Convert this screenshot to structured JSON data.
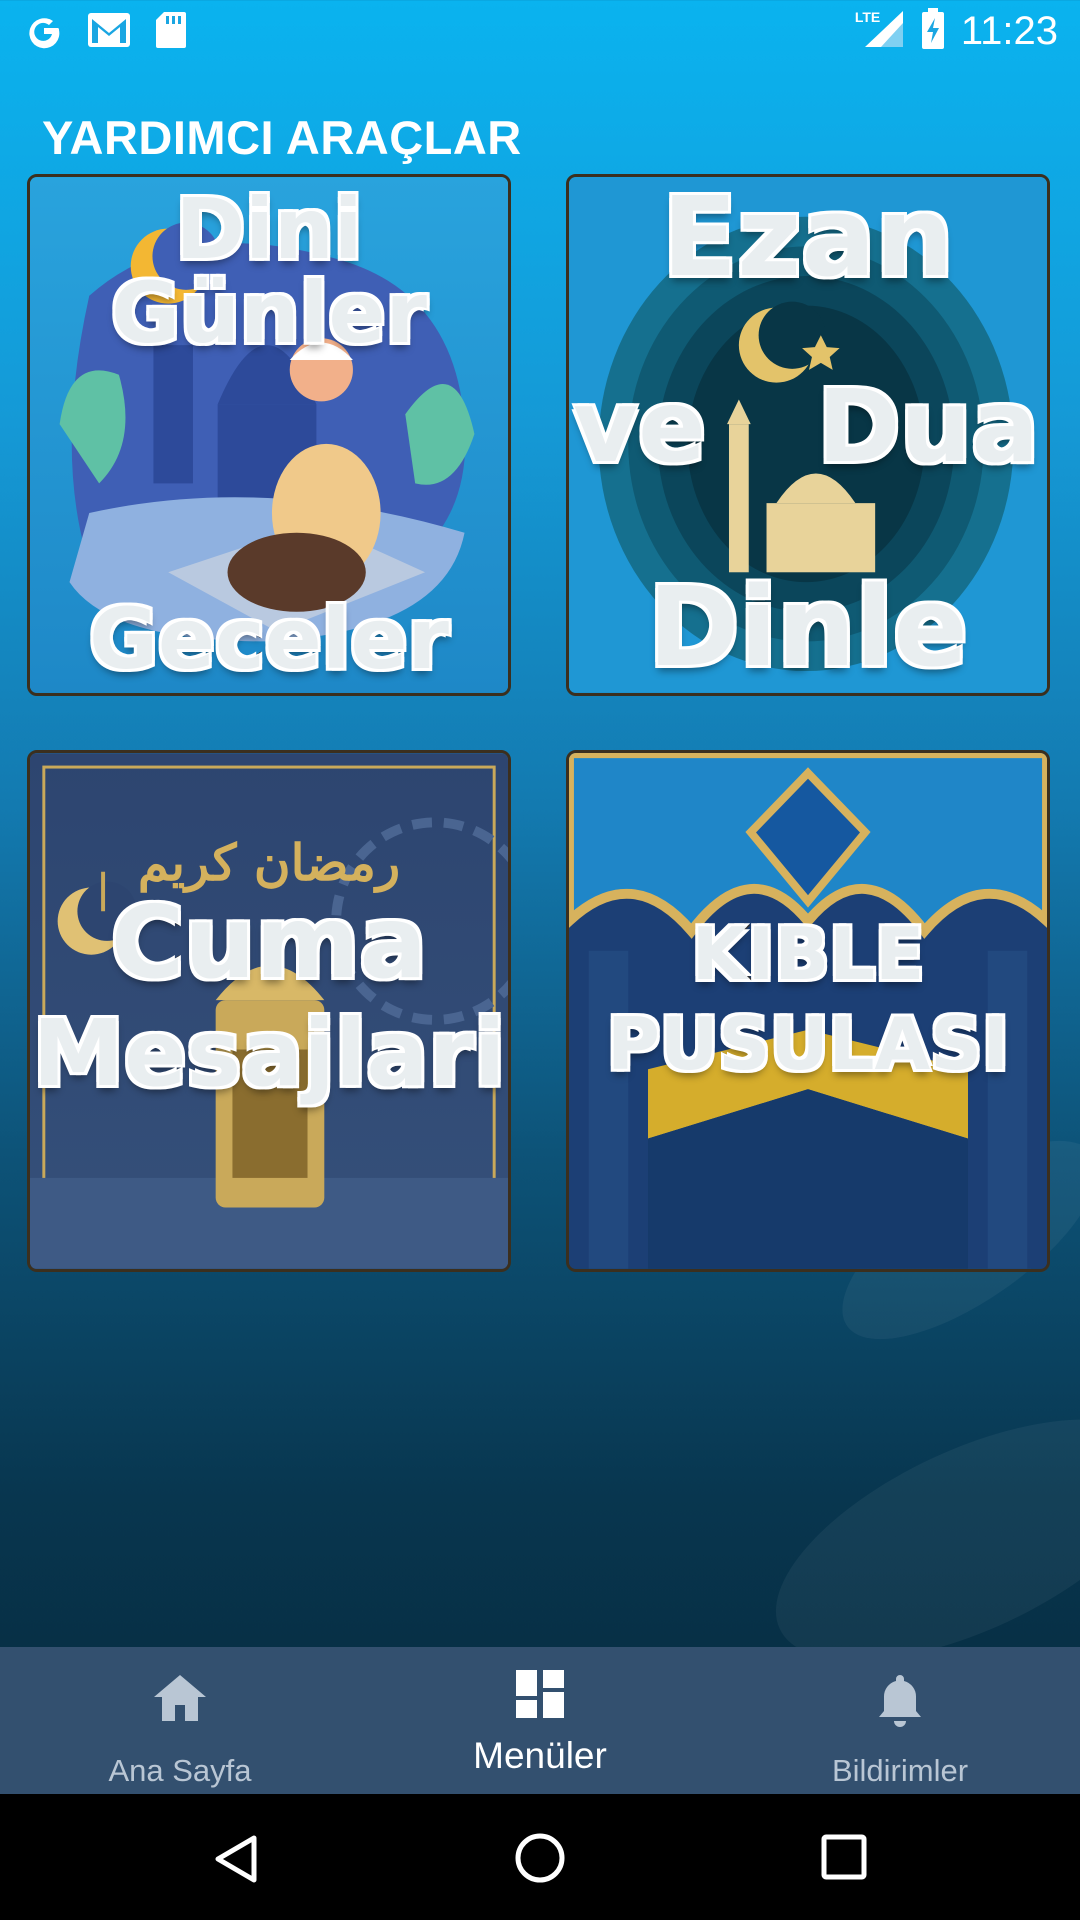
{
  "status_bar": {
    "time": "11:23",
    "network": "LTE",
    "left_icons": [
      "google-icon",
      "gmail-icon",
      "sd-card-icon"
    ],
    "right_icons": [
      "signal-icon",
      "battery-charging-icon"
    ]
  },
  "page": {
    "title": "YARDIMCI ARAÇLAR"
  },
  "cards": [
    {
      "lines": [
        "Dini Günler",
        "Geceler"
      ]
    },
    {
      "lines": [
        "Ezan",
        "ve",
        "Dua",
        "Dinle"
      ]
    },
    {
      "lines": [
        "Cuma",
        "Mesajlari"
      ],
      "arabic": "رمضان كريم"
    },
    {
      "lines": [
        "KIBLE",
        "PUSULASI"
      ]
    }
  ],
  "bottom_nav": {
    "items": [
      {
        "label": "Ana Sayfa",
        "icon": "home-icon",
        "active": false
      },
      {
        "label": "Menüler",
        "icon": "dashboard-icon",
        "active": true
      },
      {
        "label": "Bildirimler",
        "icon": "bell-icon",
        "active": false
      }
    ]
  },
  "colors": {
    "background_top": "#0ab3ef",
    "background_bottom": "#052435",
    "bottom_nav": "#33506f",
    "system_nav": "#000000"
  }
}
